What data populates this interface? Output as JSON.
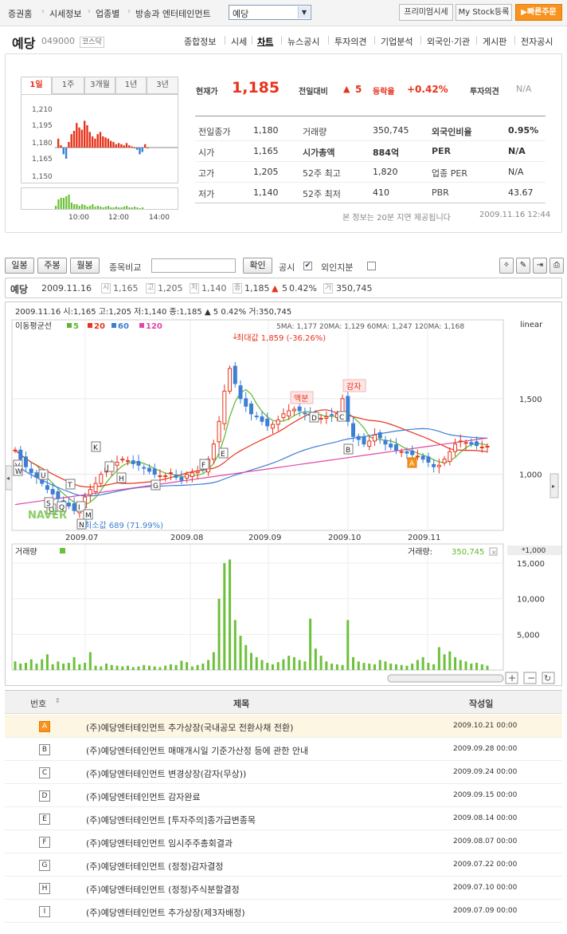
{
  "nav": {
    "breadcrumbs": [
      "증권홈",
      "시세정보",
      "업종별",
      "방송과 엔터테인먼트"
    ],
    "stock_select": "예당",
    "premium_btn": "프리미엄시세",
    "mystock_btn": "My Stock등록",
    "quick_btn": "빠른주문"
  },
  "stock": {
    "name": "예당",
    "code": "049000",
    "market": "코스닥"
  },
  "tabs": [
    "종합정보",
    "시세",
    "차트",
    "뉴스공시",
    "투자의견",
    "기업분석",
    "외국인·기관",
    "게시판",
    "전자공시"
  ],
  "period_tabs": [
    "1일",
    "1주",
    "3개월",
    "1년",
    "3년"
  ],
  "mini": {
    "y_ticks": [
      "1,210",
      "1,195",
      "1,180",
      "1,165",
      "1,150"
    ],
    "x_ticks": [
      "10:00",
      "12:00",
      "14:00"
    ]
  },
  "quote": {
    "price_label": "현재가",
    "price": "1,185",
    "change_label": "전일대비",
    "change": "5",
    "rate_label": "등락율",
    "rate": "+0.42%",
    "opinion_label": "투자의견",
    "opinion": "N/A"
  },
  "info_rows": [
    {
      "l1": "전일종가",
      "v1": "1,180",
      "l2": "거래량",
      "v2": "350,745",
      "l3": "외국인비율",
      "v3": "0.95%"
    },
    {
      "l1": "시가",
      "v1": "1,165",
      "l2": "시가총액",
      "v2": "884억",
      "l3": "PER",
      "v3": "N/A"
    },
    {
      "l1": "고가",
      "v1": "1,205",
      "l2": "52주 최고",
      "v2": "1,820",
      "l3": "업종 PER",
      "v3": "N/A"
    },
    {
      "l1": "저가",
      "v1": "1,140",
      "l2": "52주 최저",
      "v2": "410",
      "l3": "PBR",
      "v3": "43.67"
    }
  ],
  "delay_note": "본 정보는 20분 지연 제공됩니다",
  "delay_time": "2009.11.16 12:44",
  "toolbar": {
    "daily": "일봉",
    "weekly": "주봉",
    "monthly": "월봉",
    "compare_label": "종목비교",
    "confirm": "확인",
    "notice_label": "공시",
    "foreign_label": "외인지분"
  },
  "inforow": {
    "name": "예당",
    "date": "2009.11.16",
    "open": "1,165",
    "high": "1,205",
    "low": "1,140",
    "close": "1,185",
    "change": "5",
    "rate": "0.42%",
    "volume": "350,745"
  },
  "chart_header": "2009.11.16 시:1,165 고:1,205 저:1,140 종:1,185 ▲ 5 0.42% 거:350,745",
  "ma_legend": {
    "label": "이동평균선",
    "ma5": "5",
    "ma20": "20",
    "ma60": "60",
    "ma120": "120"
  },
  "ma_values": "5MA: 1,177  20MA: 1,129  60MA: 1,247  120MA: 1,168",
  "scale_label": "linear",
  "max_label": "최대값 1,859 (-36.26%)",
  "min_label": "최소값 689 (71.99%)",
  "events": {
    "rights": "액분",
    "reduction": "감자"
  },
  "vol_label": "거래량",
  "vol_value_label": "거래량:",
  "vol_value": "350,745",
  "vol_unit": "*1,000",
  "chart_data": [
    {
      "type": "candlestick",
      "title": "",
      "y_ticks": [
        "1,500",
        "1,000"
      ],
      "x_ticks": [
        "2009.07",
        "2009.08",
        "2009.09",
        "2009.10",
        "2009.11"
      ],
      "close": [
        1160,
        1100,
        1050,
        1010,
        980,
        940,
        900,
        870,
        840,
        810,
        790,
        760,
        780,
        850,
        900,
        940,
        1000,
        1040,
        1060,
        1080,
        1100,
        1090,
        1070,
        1060,
        1040,
        1020,
        1000,
        990,
        990,
        1010,
        980,
        960,
        1000,
        1010,
        1020,
        1030,
        1100,
        1200,
        1350,
        1550,
        1700,
        1600,
        1500,
        1450,
        1400,
        1380,
        1350,
        1320,
        1330,
        1360,
        1400,
        1420,
        1430,
        1420,
        1400,
        1390,
        1380,
        1370,
        1380,
        1390,
        1400,
        1500,
        1350,
        1250,
        1230,
        1200,
        1220,
        1260,
        1240,
        1200,
        1180,
        1160,
        1150,
        1140,
        1130,
        1120,
        1100,
        1080,
        1050,
        1060,
        1100,
        1150,
        1200,
        1220,
        1210,
        1200,
        1190,
        1180,
        1185
      ],
      "series": [
        {
          "name": "5",
          "color": "#5cb82d"
        },
        {
          "name": "20",
          "color": "#e8331c"
        },
        {
          "name": "60",
          "color": "#3c7fd4"
        },
        {
          "name": "120",
          "color": "#e048a8"
        }
      ]
    },
    {
      "type": "bar",
      "title": "",
      "y_ticks": [
        "15,000",
        "10,000",
        "5,000"
      ]
    }
  ],
  "table": {
    "headers": [
      "번호",
      "제목",
      "작성일"
    ],
    "rows": [
      {
        "id": "A",
        "title": "(주)예당엔터테인먼트 추가상장(국내공모 전환사채 전환)",
        "date": "2009.10.21 00:00"
      },
      {
        "id": "B",
        "title": "(주)예당엔터테인먼트 매매개시일 기준가산정 등에 관한 안내",
        "date": "2009.09.28 00:00"
      },
      {
        "id": "C",
        "title": "(주)예당엔터테인먼트 변경상장(감자(무상))",
        "date": "2009.09.24 00:00"
      },
      {
        "id": "D",
        "title": "(주)예당엔터테인먼트 감자완료",
        "date": "2009.09.15 00:00"
      },
      {
        "id": "E",
        "title": "(주)예당엔터테인먼트 [투자주의]종가급변종목",
        "date": "2009.08.14 00:00"
      },
      {
        "id": "F",
        "title": "(주)예당엔터테인먼트 임시주주총회결과",
        "date": "2009.08.07 00:00"
      },
      {
        "id": "G",
        "title": "(주)예당엔터테인먼트 (정정)감자결정",
        "date": "2009.07.22 00:00"
      },
      {
        "id": "H",
        "title": "(주)예당엔터테인먼트 (정정)주식분할결정",
        "date": "2009.07.10 00:00"
      },
      {
        "id": "I",
        "title": "(주)예당엔터테인먼트 추가상장(제3자배정)",
        "date": "2009.07.09 00:00"
      }
    ]
  },
  "colors": {
    "accent": "#e8331c",
    "up": "#e8331c",
    "down": "#3c7fd4",
    "volume": "#6cc13a",
    "orange": "#f7931e"
  }
}
